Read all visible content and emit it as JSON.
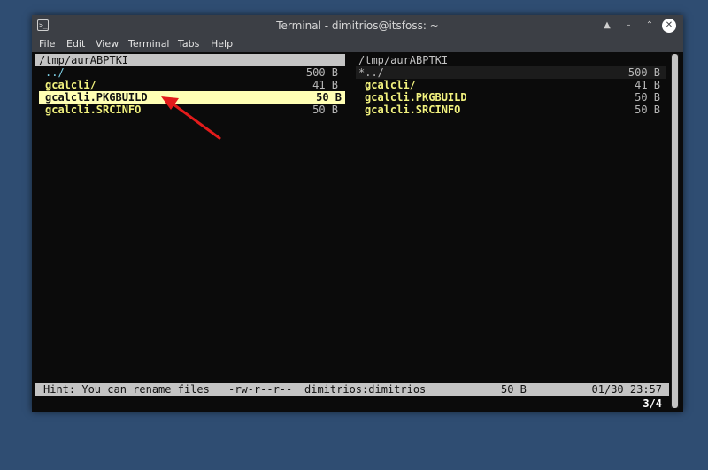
{
  "window": {
    "title": "Terminal - dimitrios@itsfoss: ~",
    "app_icon_glyph": ">_",
    "controls": {
      "shade": "▲",
      "minimize": "–",
      "maximize": "⌃",
      "close": "✕"
    }
  },
  "menu": [
    "File",
    "Edit",
    "View",
    "Terminal",
    "Tabs",
    "Help"
  ],
  "left_panel": {
    "path": "/tmp/aurABPTKI",
    "rows": [
      {
        "name": "../",
        "size": "500 B"
      },
      {
        "name": "gcalcli/",
        "size": "41 B"
      },
      {
        "name": "gcalcli.PKGBUILD",
        "size": "50 B"
      },
      {
        "name": "gcalcli.SRCINFO",
        "size": "50 B"
      }
    ]
  },
  "right_panel": {
    "path": "/tmp/aurABPTKI",
    "rows": [
      {
        "name": "*../",
        "size": "500 B"
      },
      {
        "name": "gcalcli/",
        "size": "41 B"
      },
      {
        "name": "gcalcli.PKGBUILD",
        "size": "50 B"
      },
      {
        "name": "gcalcli.SRCINFO",
        "size": "50 B"
      }
    ]
  },
  "status": {
    "hint": "Hint: You can rename files",
    "permissions": "-rw-r--r--",
    "owner": "dimitrios:dimitrios",
    "size": "50 B",
    "datetime": "01/30 23:57"
  },
  "page_indicator": "3/4",
  "colors": {
    "annotation_arrow": "#e31b1b",
    "selection": "#ffffb4",
    "bar": "#c4c4c4"
  },
  "icons": {
    "annotation": "red-arrow-icon"
  }
}
